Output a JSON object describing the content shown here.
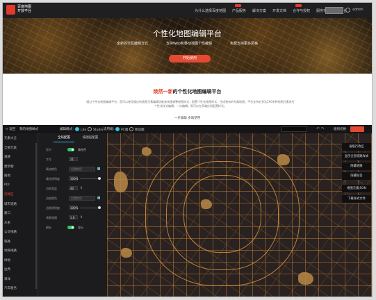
{
  "brand": {
    "line1": "百度地图",
    "line2": "开放平台"
  },
  "nav": {
    "items": [
      "为什么选择百度地图",
      "产品服务",
      "解决方案",
      "开发文档",
      "合作与授权",
      "服务市场",
      "控制台"
    ],
    "user": "admin"
  },
  "hero": {
    "title": "个性化地图编辑平台",
    "features": [
      "全新的交互编辑方式",
      "支持Web和移动地图个性编辑",
      "免费支持更多风格"
    ],
    "cta": "开始使用"
  },
  "intro": {
    "title_highlight": "焕然一新",
    "title_rest": "的个性化地图编辑平台",
    "paragraph": "通过个性化地图编辑平台，您可以使用相应的地图元素编辑功能来快速调整地图样式，配置个性化地图样式，生成独有的专属地图。平台支持对多达200余种地图元素进行个性化样式编辑，一次编辑，即可以在多端应用配置样式。",
    "links": "一步编辑  多端使用"
  },
  "editor": {
    "toolbar": {
      "back": "< 返回",
      "style_name": "我的地图样式",
      "mode_label": "编辑模式：",
      "mode_lite": "Lite",
      "mode_studio": "Studio",
      "platform_label": "适用端：",
      "platform_pc": "PC端",
      "platform_mobile": "移动端",
      "zoom_label": "级别切换"
    },
    "sidebar": {
      "items": [
        "元素大全",
        "全部元素",
        "道路",
        "建筑物",
        "陆地",
        "POI",
        "行政区",
        "城市道路",
        "路口",
        "水系",
        "公交线路",
        "铁路",
        "地铁线路",
        "绿地",
        "边界",
        "海洋",
        "汽车服务"
      ],
      "active_index": 6
    },
    "panel": {
      "tab_global": "全局配置",
      "tab_element": "按图层配置",
      "rows": {
        "visible": "显示",
        "color_label": "填充色",
        "font_size_label": "字号",
        "font_size": "21",
        "fill_label": "填充颜色",
        "fill_placeholder": "设置颜色",
        "opacity_label": "填充透明度",
        "opacity": "100%",
        "stroke_width_label": "边框宽度",
        "stroke_width": "40",
        "stroke_color_label": "边框颜色",
        "stroke_placeholder": "设置颜色",
        "stroke_opacity_label": "边框透明度",
        "stroke_opacity": "100%",
        "weight_label": "线条粗细",
        "weight": "1.8",
        "label_toggle": "图标",
        "label_on": "显示"
      }
    },
    "map_menu": [
      "省级行政区",
      "显示全部道路样式",
      "隐藏道路",
      "隐藏标签"
    ],
    "map_buttons": [
      "地图元素JSON",
      "下载样式文件"
    ]
  }
}
